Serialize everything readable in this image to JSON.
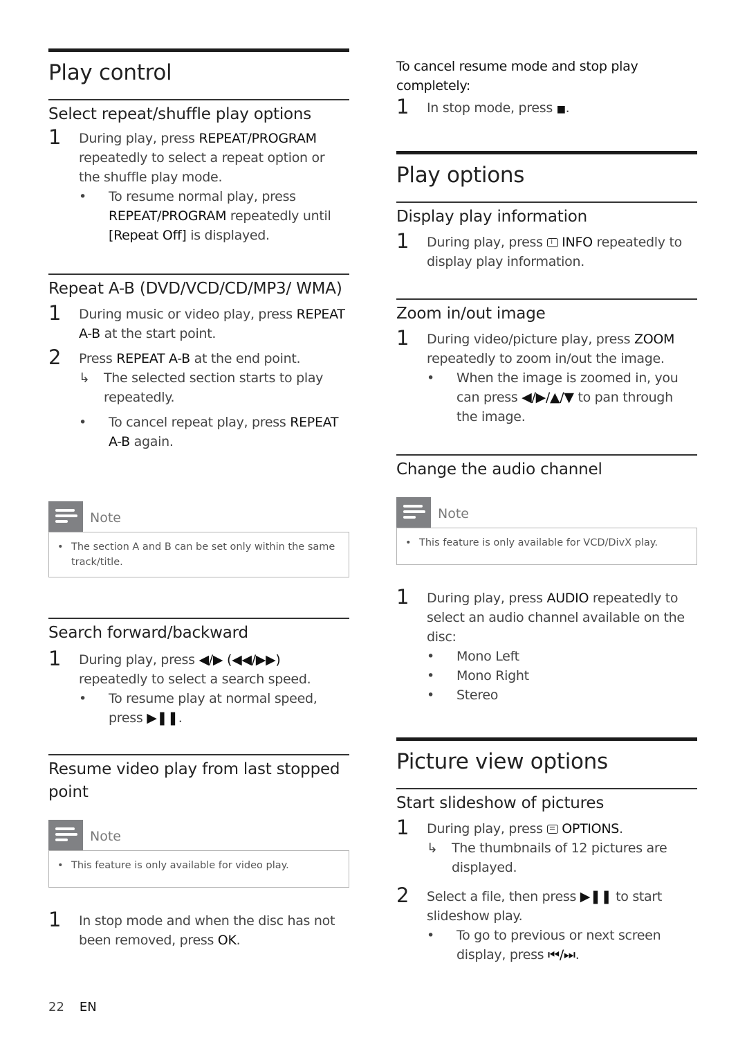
{
  "left": {
    "title": "Play control",
    "sections": {
      "repeat_shuffle": {
        "heading": "Select repeat/shuffle play options",
        "step1": {
          "num": "1",
          "pre": "During play, press ",
          "key": "REPEAT/PROGRAM",
          "post": " repeatedly to select a repeat option or the shuffle play mode."
        },
        "bullet1": {
          "pre": "To resume normal play, press ",
          "key": "REPEAT/PROGRAM",
          "mid": " repeatedly until ",
          "key2": "[Repeat Off]",
          "post": " is displayed."
        }
      },
      "repeat_ab": {
        "heading": "Repeat A-B (DVD/VCD/CD/MP3/ WMA)",
        "step1": {
          "num": "1",
          "pre": "During music or video play, press ",
          "key": "REPEAT A-B",
          "post": " at the start point."
        },
        "step2": {
          "num": "2",
          "pre": "Press ",
          "key": "REPEAT A-B",
          "post": " at the end point."
        },
        "result": "The selected section starts to play repeatedly.",
        "bullet1": {
          "pre": "To cancel repeat play, press ",
          "key": "REPEAT A-B",
          "post": " again."
        },
        "note": {
          "label": "Note",
          "text": "The section A and B can be set only within the same track/title."
        }
      },
      "search": {
        "heading": "Search forward/backward",
        "step1": {
          "num": "1",
          "pre": "During play, press ",
          "key": "◀/▶ (◀◀/▶▶)",
          "post": " repeatedly to select a search speed."
        },
        "bullet1": {
          "pre": "To resume play at normal speed, press ",
          "key": "▶❚❚",
          "post": "."
        }
      },
      "resume": {
        "heading": "Resume video play from last stopped point",
        "note": {
          "label": "Note",
          "text": "This feature is only available for video play."
        },
        "step1": {
          "num": "1",
          "pre": "In stop mode and when the disc has not been removed, press ",
          "key": "OK",
          "post": "."
        }
      }
    },
    "footer": {
      "page": "22",
      "lang": "EN"
    }
  },
  "right": {
    "cancel_resume": {
      "heading": "To cancel resume mode and stop play completely:",
      "step1": {
        "num": "1",
        "pre": "In stop mode, press ",
        "key": "■",
        "post": "."
      }
    },
    "play_options": {
      "title": "Play options",
      "display_info": {
        "heading": "Display play information",
        "step1": {
          "num": "1",
          "pre": "During play, press ",
          "key": "INFO",
          "post": " repeatedly to display play information."
        }
      },
      "zoom": {
        "heading": "Zoom in/out image",
        "step1": {
          "num": "1",
          "pre": "During video/picture play, press ",
          "key": "ZOOM",
          "post": " repeatedly to zoom in/out the image."
        },
        "bullet1": {
          "pre": "When the image is zoomed in, you can press ",
          "key": "◀/▶/▲/▼",
          "post": " to pan through the image."
        }
      },
      "audio": {
        "heading": "Change the audio channel",
        "note": {
          "label": "Note",
          "text": "This feature is only available for VCD/DivX play."
        },
        "step1": {
          "num": "1",
          "pre": "During play, press ",
          "key": "AUDIO",
          "post": " repeatedly to select an audio channel available on the disc:"
        },
        "options": [
          "Mono Left",
          "Mono Right",
          "Stereo"
        ]
      }
    },
    "picture_view": {
      "title": "Picture view options",
      "slideshow": {
        "heading": "Start slideshow of pictures",
        "step1": {
          "num": "1",
          "pre": "During play, press ",
          "key": "OPTIONS",
          "post": "."
        },
        "result": "The thumbnails of 12 pictures are displayed.",
        "step2": {
          "num": "2",
          "pre": "Select a file, then press ",
          "key": "▶❚❚",
          "post": " to start slideshow play."
        },
        "bullet1": {
          "pre": "To go to previous or next screen display, press ",
          "key": "⏮/⏭",
          "post": "."
        }
      }
    }
  },
  "symbols": {
    "bullet": "•",
    "arrow": "↳"
  },
  "colors": {
    "note_icon_bg": "#808184",
    "rule": "#1c1c1c",
    "text": "#444444"
  }
}
